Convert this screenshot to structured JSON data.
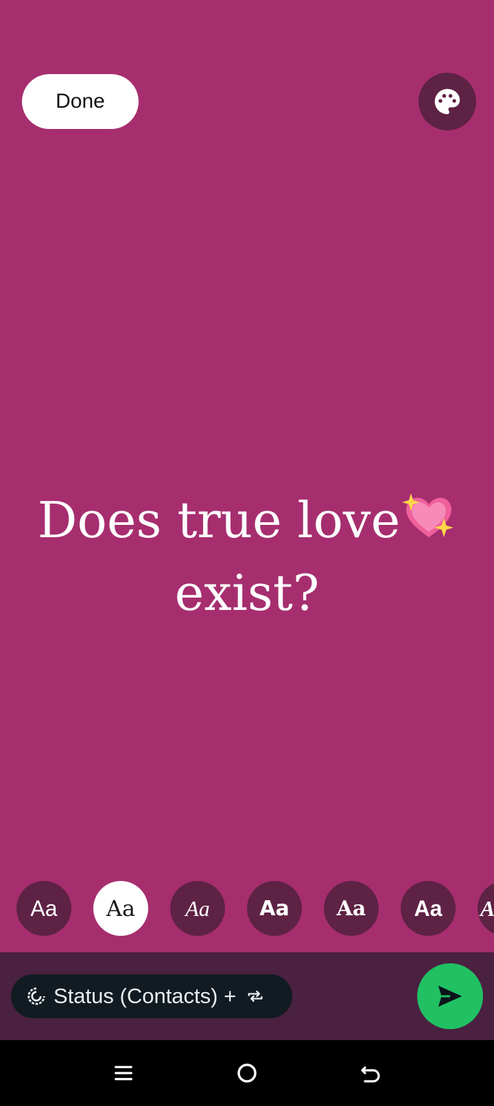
{
  "header": {
    "done_label": "Done",
    "palette_icon": "palette-icon"
  },
  "status": {
    "text_line1": "Does true love",
    "text_line2": "exist?",
    "emoji": "sparkling-heart"
  },
  "font_options": [
    {
      "label": "Aa",
      "style": "sans",
      "selected": false
    },
    {
      "label": "Aa",
      "style": "serif",
      "selected": true
    },
    {
      "label": "Aa",
      "style": "script",
      "selected": false
    },
    {
      "label": "Aa",
      "style": "rounded-bold",
      "selected": false
    },
    {
      "label": "Aa",
      "style": "slab-bold",
      "selected": false
    },
    {
      "label": "Aa",
      "style": "condensed-bold",
      "selected": false
    },
    {
      "label": "Aa",
      "style": "partial",
      "selected": false
    }
  ],
  "footer": {
    "audience_label": "Status (Contacts) +",
    "status_icon": "status-ring-icon",
    "repeat_icon": "repeat-icon",
    "send_icon": "send-icon"
  },
  "colors": {
    "background": "#a62e6f",
    "chip": "#5e2244",
    "bottom_bar": "#4a2140",
    "send": "#21c063"
  }
}
